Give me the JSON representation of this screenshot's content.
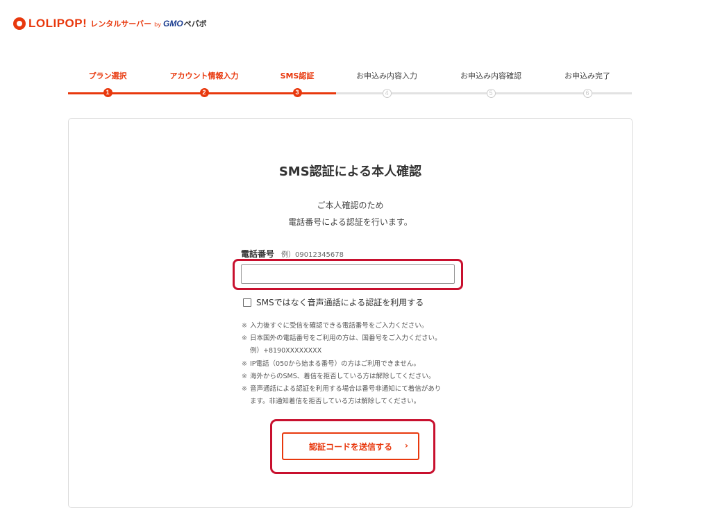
{
  "brand": {
    "logo_text": "LOLIPOP!",
    "sub_text": "レンタルサーバー",
    "by_text": "by",
    "company": "GMO",
    "company_sub": "ペパボ",
    "color": "#e8380d"
  },
  "stepper": {
    "steps": [
      {
        "label": "プラン選択",
        "number": "1",
        "state": "done"
      },
      {
        "label": "アカウント情報入力",
        "number": "2",
        "state": "done"
      },
      {
        "label": "SMS認証",
        "number": "3",
        "state": "current"
      },
      {
        "label": "お申込み内容入力",
        "number": "4",
        "state": "pending"
      },
      {
        "label": "お申込み内容確認",
        "number": "5",
        "state": "pending"
      },
      {
        "label": "お申込み完了",
        "number": "6",
        "state": "pending"
      }
    ]
  },
  "form": {
    "title": "SMS認証による本人確認",
    "description": [
      "ご本人確認のため",
      "電話番号による認証を行います。"
    ],
    "phone_label": "電話番号",
    "phone_example": "例）09012345678",
    "phone_value": "",
    "voice_option_label": "SMSではなく音声通話による認証を利用する",
    "voice_option_checked": false,
    "notes": [
      {
        "mark": "※",
        "lines": [
          "入力後すぐに受信を確認できる電話番号をご入力ください。"
        ]
      },
      {
        "mark": "※",
        "lines": [
          "日本国外の電話番号をご利用の方は、国番号をご入力ください。",
          "例）+8190XXXXXXXX"
        ]
      },
      {
        "mark": "※",
        "lines": [
          "IP電話（050から始まる番号）の方はご利用できません。"
        ]
      },
      {
        "mark": "※",
        "lines": [
          "海外からのSMS、着信を拒否している方は解除してください。"
        ]
      },
      {
        "mark": "※",
        "lines": [
          "音声通話による認証を利用する場合は番号非通知にて着信があり",
          "ます。非通知着信を拒否している方は解除してください。"
        ]
      }
    ],
    "submit_label": "認証コードを送信する",
    "submit_arrow": "›"
  }
}
